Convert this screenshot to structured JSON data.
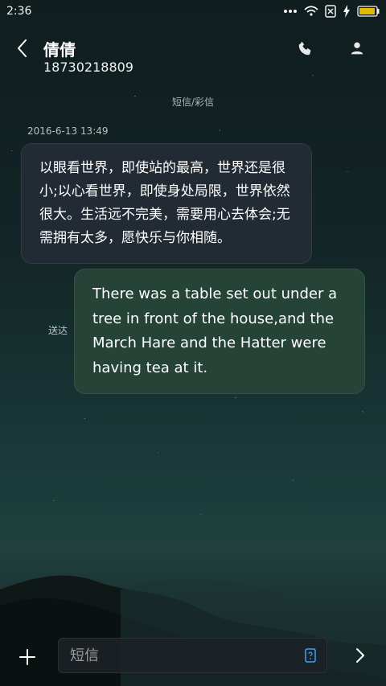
{
  "status_bar": {
    "time": "2:36",
    "icons": [
      "dots-icon",
      "wifi-icon",
      "sim-card-icon",
      "charging-icon",
      "battery-icon"
    ]
  },
  "header": {
    "contact_name": "倩倩",
    "contact_number": "18730218809",
    "actions": [
      "phone-icon",
      "person-icon"
    ]
  },
  "conversation": {
    "channel_label": "短信/彩信",
    "timestamp": "2016-6-13 13:49",
    "messages": [
      {
        "direction": "incoming",
        "text": "以眼看世界，即使站的最高，世界还是很小;以心看世界，即使身处局限，世界依然很大。生活远不完美，需要用心去体会;无需拥有太多，愿快乐与你相随。"
      },
      {
        "direction": "outgoing",
        "text": "There was a table set out under a tree in front of the house,and the March Hare and the Hatter were having tea at it."
      }
    ],
    "sent_status": "送达"
  },
  "composer": {
    "placeholder": "短信",
    "add_icon": "plus-icon",
    "sim_icon": "sim-icon",
    "send_icon": "chevron-right-icon"
  },
  "colors": {
    "incoming_bubble": "#242c37",
    "outgoing_bubble": "#284738",
    "accent": "#3ea0ff"
  }
}
